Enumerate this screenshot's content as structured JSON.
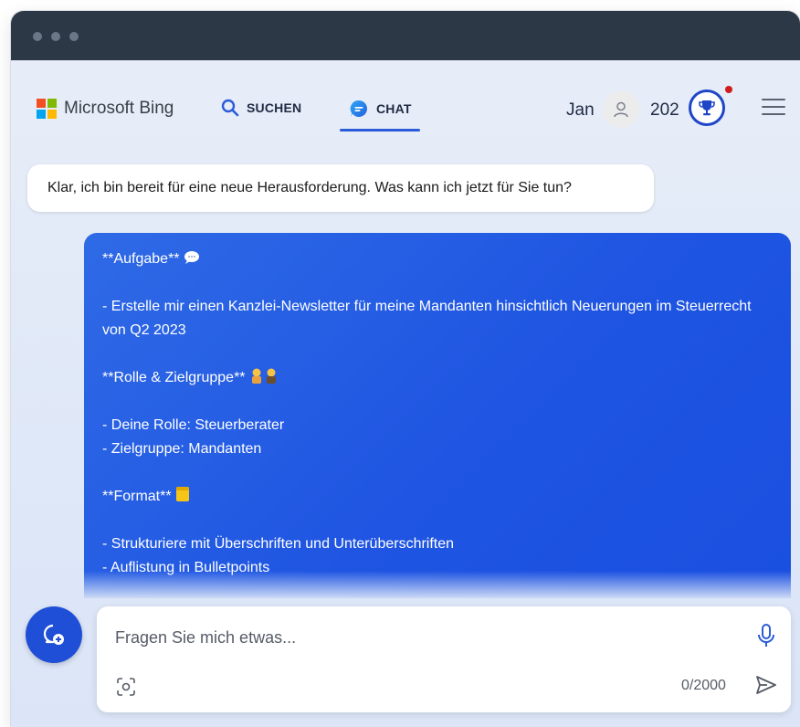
{
  "header": {
    "logo_text": "Microsoft Bing",
    "nav_search": "SUCHEN",
    "nav_chat": "CHAT",
    "user_name": "Jan",
    "points": "202"
  },
  "conversation": {
    "bot_message": "Klar, ich bin bereit für eine neue Herausforderung. Was kann ich jetzt für Sie tun?",
    "user_message": {
      "line1": "**Aufgabe**",
      "line2": "- Erstelle mir einen Kanzlei-Newsletter für meine Mandanten hinsichtlich Neuerungen im Steuerrecht von Q2 2023",
      "line3": "**Rolle & Zielgruppe**",
      "line4": "- Deine Rolle: Steuerberater",
      "line5": "- Zielgruppe: Mandanten",
      "line6": "**Format**",
      "line7": "- Strukturiere mit Überschriften und Unterüberschriften",
      "line8": "- Auflistung in Bulletpoints"
    }
  },
  "composer": {
    "placeholder": "Fragen Sie mich etwas...",
    "counter": "0/2000"
  },
  "colors": {
    "accent": "#2b5bd8",
    "user_bubble": "#1f55e2",
    "titlebar": "#2d3846"
  },
  "icons": [
    "search-icon",
    "chat-icon",
    "user-icon",
    "trophy-icon",
    "menu-icon",
    "new-topic-icon",
    "mic-icon",
    "visual-search-icon",
    "send-icon"
  ]
}
